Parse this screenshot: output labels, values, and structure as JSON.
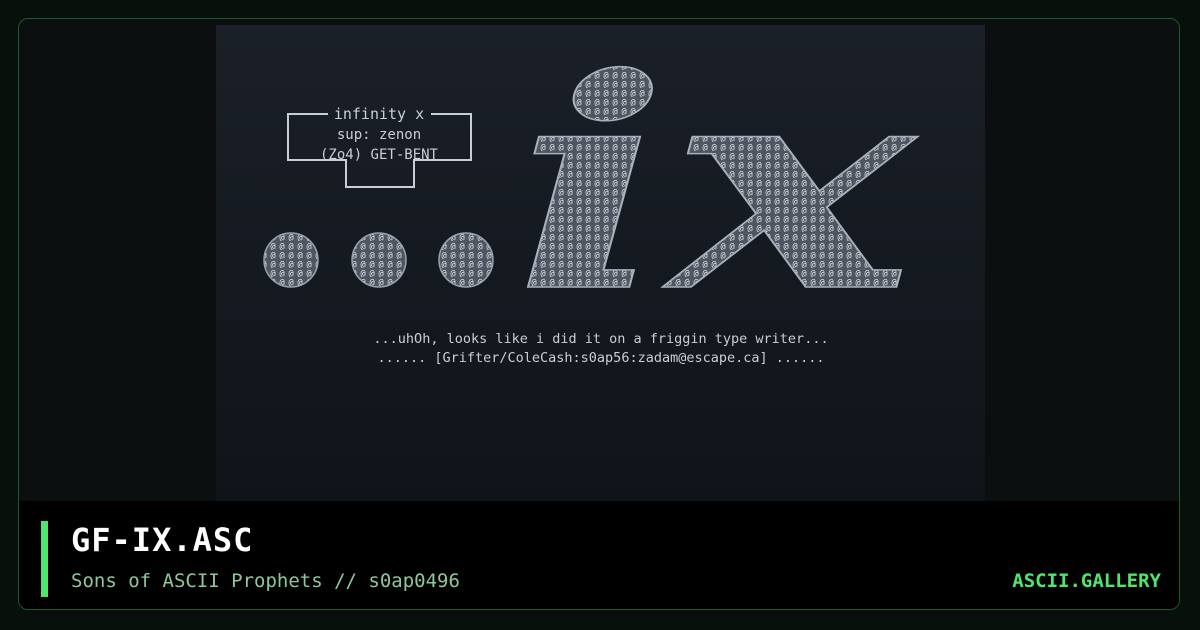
{
  "artwork": {
    "box_line1": "infinity x",
    "box_line2": "sup: zenon",
    "box_line3": "(Zo4) GET-BENT",
    "dots_glyph": "...",
    "big_letters": "ix",
    "caption_line1": "...uhOh, looks like i did it on a friggin type writer...",
    "caption_line2": "...... [Grifter/ColeCash:s0ap56:zadam@escape.ca] ......"
  },
  "footer": {
    "title": "GF-IX.ASC",
    "subtitle": "Sons of ASCII Prophets // s0ap0496",
    "brand": "ASCII.GALLERY"
  },
  "colors": {
    "accent": "#4ee66f",
    "border": "#1f5a2c",
    "subtitle": "#8fc79b",
    "ascii_fill": "#c9ced6"
  }
}
